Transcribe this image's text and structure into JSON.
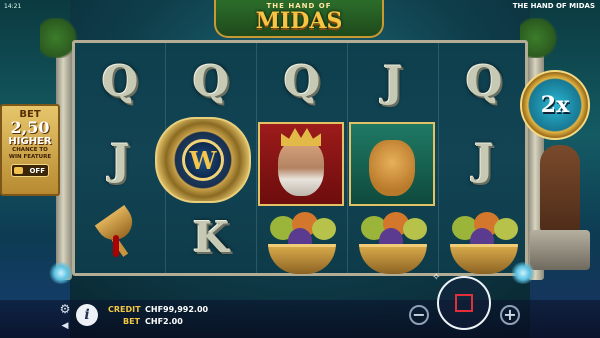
{
  "status": {
    "time": "14:21",
    "game_title": "THE HAND OF MIDAS"
  },
  "logo": {
    "small": "THE HAND OF",
    "big": "MIDAS"
  },
  "bet_feature": {
    "title": "BET",
    "value": "2,50",
    "higher": "HIGHER",
    "desc_line1": "CHANCE TO",
    "desc_line2": "WIN FEATURE",
    "toggle": "OFF"
  },
  "multiplier": "2x",
  "reels": {
    "columns": [
      [
        "Q",
        "J",
        "goblet"
      ],
      [
        "Q",
        "wild",
        "K"
      ],
      [
        "Q",
        "king",
        "fruit-basket"
      ],
      [
        "J",
        "princess",
        "fruit-basket"
      ],
      [
        "Q",
        "J",
        "fruit-basket"
      ]
    ],
    "wild_letter": "W"
  },
  "credit": {
    "label": "CREDIT",
    "value": "CHF99,992.00"
  },
  "bet": {
    "label": "BET",
    "value": "CHF2.00"
  },
  "controls": {
    "minus": "−",
    "plus": "+",
    "info": "i",
    "autoplay_glyph": "✧"
  },
  "colors": {
    "accent_gold": "#f2c744",
    "spin_icon_red": "#e2303b"
  }
}
